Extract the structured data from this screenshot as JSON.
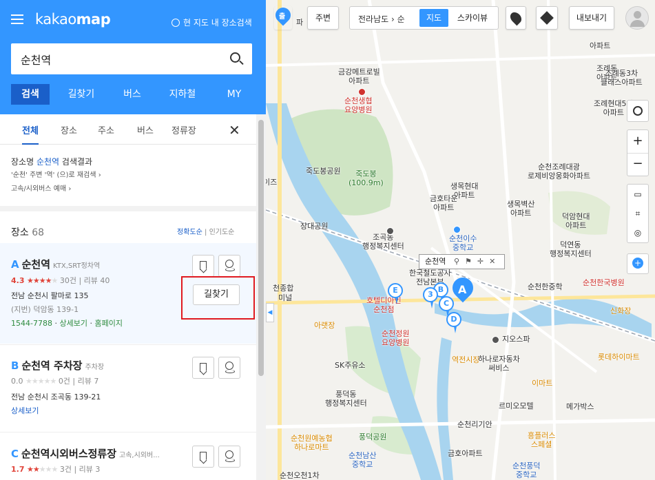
{
  "header": {
    "logo_light": "kakao",
    "logo_bold": "map",
    "map_search_label": "현 지도 내 장소검색",
    "search_value": "순천역",
    "nav_tabs": [
      "검색",
      "길찾기",
      "버스",
      "지하철",
      "MY"
    ]
  },
  "category_tabs": [
    "전체",
    "장소",
    "주소",
    "버스",
    "정류장"
  ],
  "info": {
    "line1_pre": "장소명",
    "line1_query": "순천역",
    "line1_post": "검색결과",
    "line2": "'순천' 주변 '역' (으)로 재검색 ›",
    "line3": "고속/시외버스 예매 ›"
  },
  "places": {
    "title": "장소",
    "count": "68",
    "sort_accuracy": "정확도순",
    "sort_sep": "|",
    "sort_popular": "인기도순"
  },
  "results": [
    {
      "marker": "A",
      "name": "순천역",
      "category": "KTX,SRT정차역",
      "score": "4.3",
      "stars_filled": 4,
      "reviews_count": "30건",
      "review_label": "리뷰 40",
      "address": "전남 순천시 팔마로 135",
      "jibun": "(지번) 덕암동 139-1",
      "phone": "1544-7788",
      "detail": "상세보기",
      "homepage": "홈페이지",
      "route_button": "길찾기"
    },
    {
      "marker": "B",
      "name": "순천역 주차장",
      "category": "주차장",
      "score": "0.0",
      "stars_filled": 0,
      "reviews_count": "0건",
      "review_label": "리뷰 7",
      "address": "전남 순천시 조곡동 139-21",
      "detail": "상세보기"
    },
    {
      "marker": "C",
      "name": "순천역시외버스정류장",
      "category": "고속,시외버...",
      "score": "1.7",
      "stars_filled": 2,
      "reviews_count": "3건",
      "review_label": "리뷰 3"
    }
  ],
  "map": {
    "top_left_btn": "출",
    "top_left_btn_sub": "파",
    "nearby_btn": "주변",
    "breadcrumb": "전라남도 › 순",
    "view_map": "지도",
    "view_sky": "스카이뷰",
    "export_btn": "내보내기",
    "popup_title": "순천역",
    "labels": [
      "금강메트로빌\n아파트",
      "순천생협\n요양병원",
      "죽도봉공원",
      "죽도봉\n(100.9m)",
      "장대공원",
      "조곡동\n행정복지센터",
      "생목현대\n아파트",
      "금호타운\n아파트",
      "생목벽산\n아파트",
      "순천이수\n중학교",
      "한국철도공사\n전남본부",
      "호텔디아인\n순천점",
      "아랫장",
      "순천정원\n요양병원",
      "역전시장",
      "지오스파",
      "하나로자동차\n써비스",
      "SK주유소",
      "풍덕동\n행정복지센터",
      "르미오모텔",
      "순천리기안",
      "풍덕공원",
      "순천원예농협\n하나로마트",
      "순천남산\n중학교",
      "금호아파트",
      "흥플러스\n스페셜",
      "순천풍덕\n중학교",
      "순천오천1차",
      "조례동\n아파트",
      "조례동3차\n클래스아파트",
      "조례현대5차\n아파트",
      "순천조례대광\n로제비앙웅화아파트",
      "덕암현대\n아파트",
      "덕연동\n행정복지센터",
      "순천한중학",
      "순천한국병원",
      "신화장",
      "롯데하이마트",
      "이마트",
      "메가박스",
      "조곡동 아파트",
      "아파트",
      "아파트",
      "이즈",
      "천종합",
      "미널",
      "기원"
    ]
  },
  "colors": {
    "brand": "#3396ff",
    "nav_active": "#1a5fc9",
    "rating": "#e0443a",
    "highlight_box": "#e0191f"
  }
}
